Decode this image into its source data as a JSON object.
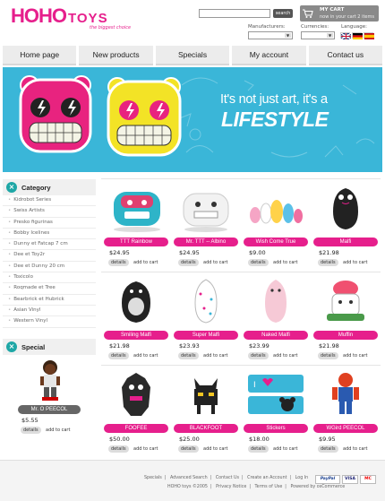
{
  "logo": {
    "brand": "HOHO",
    "suffix": "TOYS",
    "tagline": "the biggest choice"
  },
  "search": {
    "value": "",
    "button_label": "search"
  },
  "cart": {
    "title": "MY CART",
    "subtitle": "now in your cart 2 items"
  },
  "selectors": {
    "manufacturers_label": "Manufacturers:",
    "currencies_label": "Currencies:",
    "language_label": "Language:"
  },
  "nav": [
    "Home page",
    "New products",
    "Specials",
    "My account",
    "Contact us"
  ],
  "banner": {
    "line1": "It's not just art, it's a",
    "line2": "LIFESTYLE"
  },
  "category": {
    "title": "Category",
    "items": [
      "Kidrobot Series",
      "Swiss Artists",
      "Presko figurinas",
      "Bobby Icelines",
      "Dunny et Fatcap 7 cm",
      "Dee et Toy2r",
      "Dee et Dunny 20 cm",
      "Toxicolo",
      "Roqmade et Tree",
      "Bearbrick et Hubrick",
      "Asian Vinyl",
      "Western Vinyl"
    ]
  },
  "special": {
    "title": "Special",
    "product_name": "Mr. O PEECOL",
    "price": "$5.55",
    "details_label": "details",
    "add_label": "add to cart"
  },
  "products": [
    {
      "name": "TTT Rainbow",
      "price": "$24.95",
      "details": "details",
      "add": "add to cart"
    },
    {
      "name": "Mr. TTT -- Albino",
      "price": "$24.95",
      "details": "details",
      "add": "add to cart"
    },
    {
      "name": "Wish Come True",
      "price": "$9.00",
      "details": "details",
      "add": "add to cart"
    },
    {
      "name": "Malfi",
      "price": "$21.98",
      "details": "details",
      "add": "add to cart"
    },
    {
      "name": "Smiling Malfi",
      "price": "$21.98",
      "details": "details",
      "add": "add to cart"
    },
    {
      "name": "Super Malfi",
      "price": "$23.93",
      "details": "details",
      "add": "add to cart"
    },
    {
      "name": "Naked Malfi",
      "price": "$23.99",
      "details": "details",
      "add": "add to cart"
    },
    {
      "name": "Muffin",
      "price": "$21.98",
      "details": "details",
      "add": "add to cart"
    },
    {
      "name": "FOOFEE",
      "price": "$50.00",
      "details": "details",
      "add": "add to cart"
    },
    {
      "name": "BLACKFOOT",
      "price": "$25.00",
      "details": "details",
      "add": "add to cart"
    },
    {
      "name": "Stickers",
      "price": "$18.00",
      "details": "details",
      "add": "add to cart"
    },
    {
      "name": "WGird PEECOL",
      "price": "$9.95",
      "details": "details",
      "add": "add to cart"
    }
  ],
  "footer": {
    "links1": [
      "Specials",
      "Advanced Search",
      "Contact Us",
      "Create an Account",
      "Log In"
    ],
    "links2": [
      "HOHO toys ©2005",
      "Privacy Notice",
      "Terms of Use",
      "Powered by osCommerce"
    ],
    "payments": [
      "PayPal",
      "VISA",
      "MC"
    ]
  },
  "colors": {
    "accent": "#e61f8c",
    "banner": "#3ab6d8",
    "teal": "#1ea7a6"
  }
}
